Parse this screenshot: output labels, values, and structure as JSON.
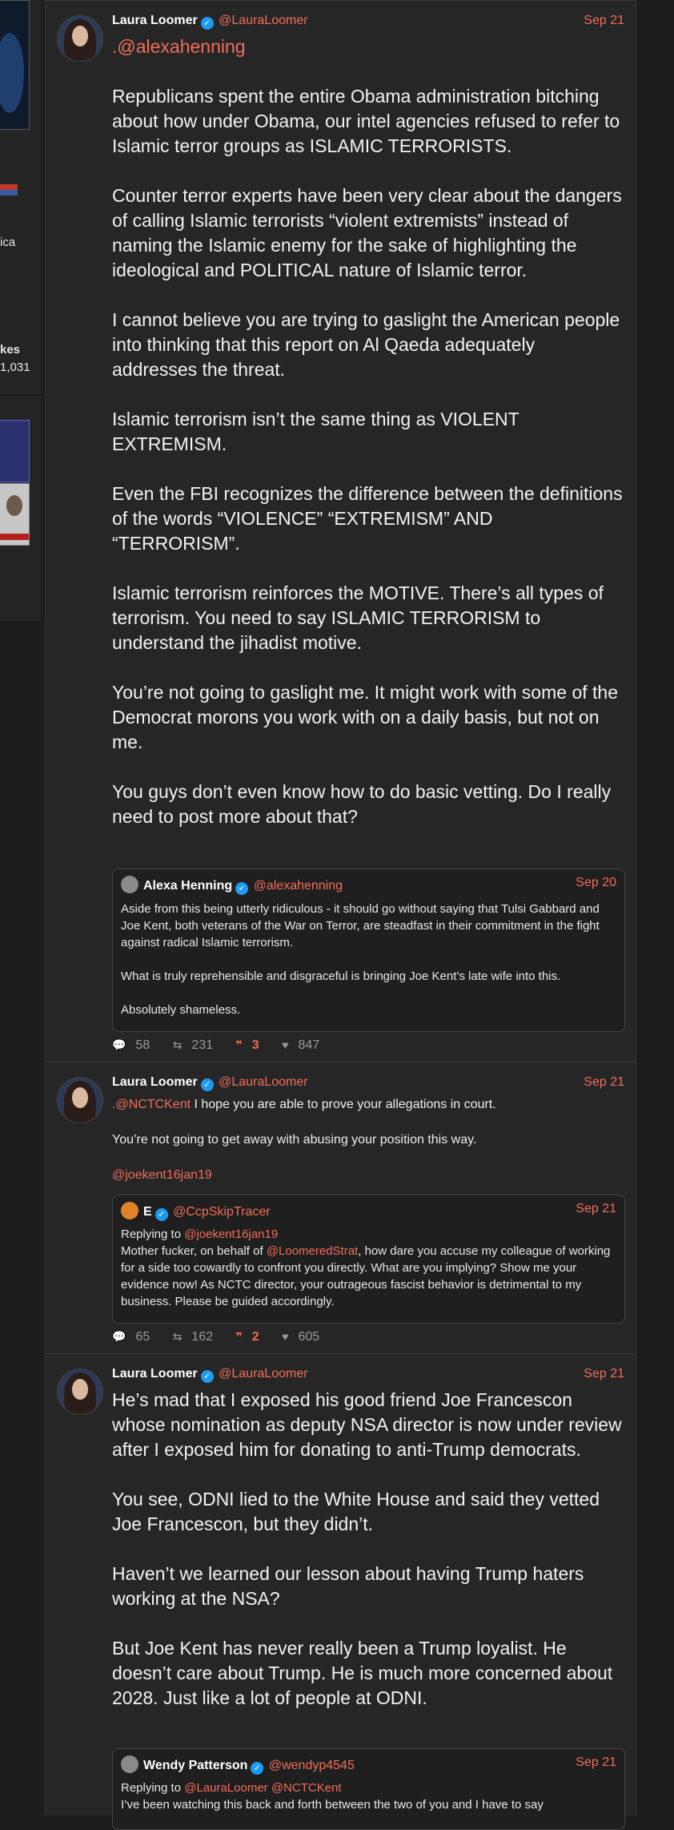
{
  "left_column": {
    "line1": "ica",
    "line2": "kes",
    "line3": "1,031"
  },
  "posts": [
    {
      "author": "Laura Loomer",
      "handle": "@LauraLoomer",
      "date": "Sep 21",
      "mention_prefix": ".",
      "mention": "@alexahenning",
      "paragraphs": [
        "Republicans spent the entire Obama administration bitching about how under Obama, our intel agencies refused to refer to Islamic terror groups as ISLAMIC TERRORISTS.",
        "Counter terror experts have been very clear about the dangers of calling Islamic terrorists “violent extremists” instead of naming the Islamic enemy for the sake of highlighting the ideological and POLITICAL nature of Islamic terror.",
        "I cannot believe you are trying to gaslight the American people into thinking that this report on Al Qaeda adequately addresses the threat.",
        "Islamic terrorism isn’t the same thing as VIOLENT EXTREMISM.",
        "Even the FBI recognizes the difference between the definitions of the words “VIOLENCE” “EXTREMISM” AND “TERRORISM”.",
        "Islamic terrorism reinforces the MOTIVE. There’s all types of terrorism. You need to say ISLAMIC TERRORISM to understand the jihadist motive.",
        "You’re not going to gaslight me. It might work with some of the Democrat morons you work with on a daily basis, but not on me.",
        "You guys don’t even know how to do basic vetting. Do I really need to post more about that?"
      ],
      "quote": {
        "author": "Alexa Henning",
        "handle": "@alexahenning",
        "date": "Sep 20",
        "paragraphs": [
          "Aside from this being utterly ridiculous - it should go without saying that Tulsi Gabbard and Joe Kent, both veterans of the War on Terror, are steadfast in their commitment in the fight against radical Islamic terrorism.",
          "What is truly reprehensible and disgraceful is bringing Joe Kent’s late wife into this.",
          "Absolutely shameless."
        ]
      },
      "stats": {
        "replies": "58",
        "reposts": "231",
        "quotes": "3",
        "likes": "847"
      }
    },
    {
      "author": "Laura Loomer",
      "handle": "@LauraLoomer",
      "date": "Sep 21",
      "mention_prefix": ".",
      "mention": "@NCTCKent",
      "first_line_rest": " I hope you are able to prove your allegations in court.",
      "paragraph2": "You’re not going to get away with abusing your position this way.",
      "tag": "@joekent16jan19",
      "quote": {
        "author": "E",
        "handle": "@CcpSkipTracer",
        "date": "Sep 21",
        "replying_label": "Replying to ",
        "replying_to": "@joekent16jan19",
        "text_before": "Mother fucker, on behalf of ",
        "text_mention": "@LoomeredStrat",
        "text_after": ", how dare you accuse my colleague of working for a side too cowardly to confront you directly. What are you implying? Show me your evidence now! As NCTC director, your outrageous fascist behavior is detrimental to my business. Please be guided accordingly."
      },
      "stats": {
        "replies": "65",
        "reposts": "162",
        "quotes": "2",
        "likes": "605"
      }
    },
    {
      "author": "Laura Loomer",
      "handle": "@LauraLoomer",
      "date": "Sep 21",
      "paragraphs": [
        "He’s mad that I exposed his good friend Joe Francescon whose nomination as deputy NSA director is now under review after I exposed him for donating to anti-Trump democrats.",
        "You see, ODNI lied to the White House and said they vetted Joe Francescon, but they didn’t.",
        "Haven’t we learned our lesson about having Trump haters working at the NSA?",
        "But Joe Kent has never really been a Trump loyalist. He doesn’t care about Trump. He is much more concerned about 2028. Just like a lot of people at ODNI."
      ],
      "quote": {
        "author": "Wendy Patterson",
        "handle": "@wendyp4545",
        "date": "Sep 21",
        "replying_label": "Replying to ",
        "replying_to": "@LauraLoomer @NCTCKent",
        "text": "I’ve been watching this back and forth between the two of you and I have to say"
      }
    }
  ],
  "icons": {
    "verified": "verified-badge-icon",
    "reply": "reply-icon",
    "repost": "repost-icon",
    "quote": "quote-icon",
    "like": "like-icon"
  },
  "colors": {
    "accent": "#f26d5b",
    "verified": "#1d9bf0",
    "background": "#262626"
  }
}
